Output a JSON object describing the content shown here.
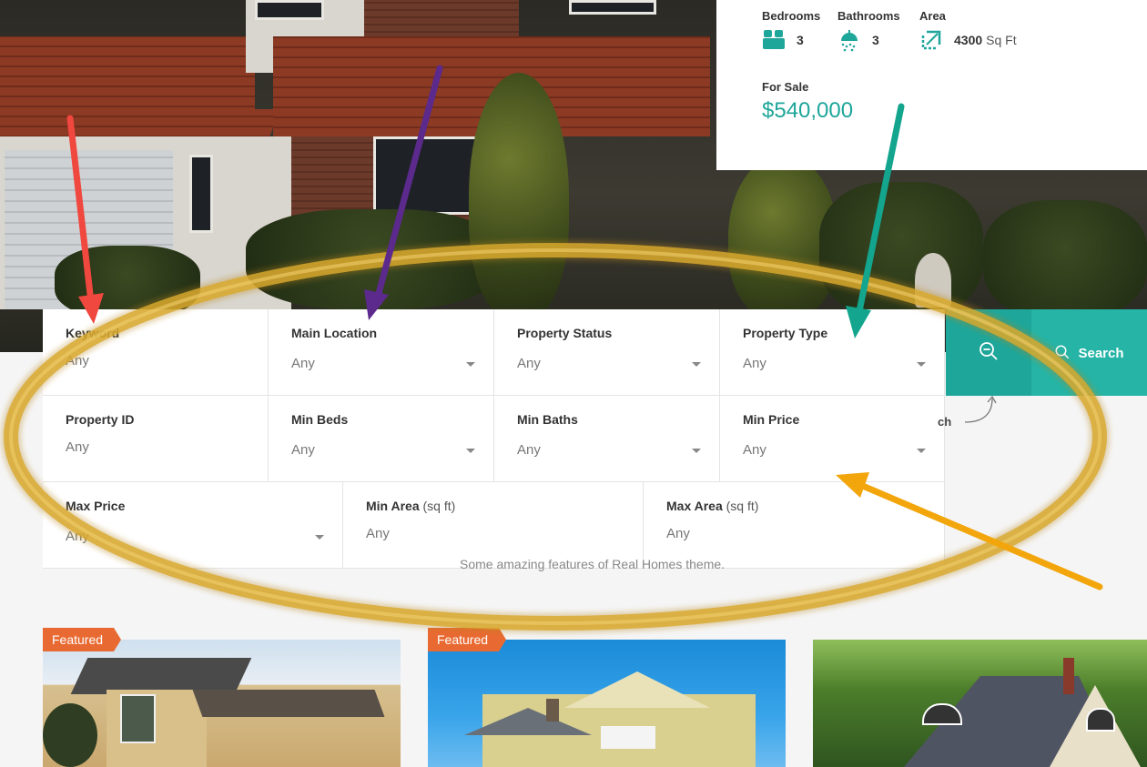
{
  "card": {
    "specs": [
      {
        "label": "Bedrooms",
        "value": "3",
        "unit": "",
        "icon": "bed-icon"
      },
      {
        "label": "Bathrooms",
        "value": "3",
        "unit": "",
        "icon": "shower-icon"
      },
      {
        "label": "Area",
        "value": "4300",
        "unit": "Sq Ft",
        "icon": "area-icon"
      }
    ],
    "status": "For Sale",
    "price": "$540,000"
  },
  "search": {
    "fields": [
      {
        "label": "Keyword",
        "value": "Any"
      },
      {
        "label": "Main Location",
        "value": "Any"
      },
      {
        "label": "Property Status",
        "value": "Any"
      },
      {
        "label": "Property Type",
        "value": "Any"
      },
      {
        "label": "Property ID",
        "value": "Any"
      },
      {
        "label": "Min Beds",
        "value": "Any"
      },
      {
        "label": "Min Baths",
        "value": "Any"
      },
      {
        "label": "Min Price",
        "value": "Any"
      },
      {
        "label": "Max Price",
        "value": "Any"
      },
      {
        "label": "Min Area",
        "sub": "(sq ft)",
        "value": "Any"
      },
      {
        "label": "Max Area",
        "sub": "(sq ft)",
        "value": "Any"
      }
    ],
    "search_button": "Search",
    "advanced_hint": "ch"
  },
  "features_subtitle": "Some amazing features of Real Homes theme.",
  "listings": [
    {
      "badge": "Featured"
    },
    {
      "badge": "Featured"
    },
    {
      "badge": ""
    }
  ],
  "colors": {
    "accent": "#1ea69a",
    "badge": "#e86a32",
    "arrow_red": "#f0473f",
    "arrow_purple": "#5b2a8c",
    "arrow_teal": "#13a58e",
    "arrow_orange": "#f2a60c",
    "ring": "#d9a92e"
  }
}
